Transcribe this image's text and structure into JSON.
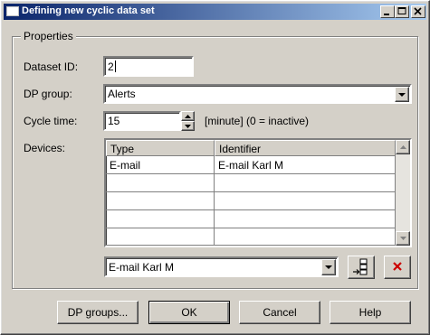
{
  "window": {
    "title": "Defining new cyclic data set"
  },
  "group": {
    "legend": "Properties"
  },
  "dataset": {
    "label": "Dataset ID:",
    "value": "2"
  },
  "dp_group": {
    "label": "DP group:",
    "selected": "Alerts"
  },
  "cycle": {
    "label": "Cycle time:",
    "value": "15",
    "hint": "[minute] (0 = inactive)"
  },
  "devices": {
    "label": "Devices:",
    "columns": [
      "Type",
      "Identifier"
    ],
    "rows": [
      [
        "E-mail",
        "E-mail Karl M"
      ],
      [
        "",
        ""
      ],
      [
        "",
        ""
      ],
      [
        "",
        ""
      ],
      [
        "",
        ""
      ]
    ],
    "selector_value": "E-mail Karl M"
  },
  "buttons": {
    "dp_groups": "DP groups...",
    "ok": "OK",
    "cancel": "Cancel",
    "help": "Help"
  },
  "icons": {
    "add_device": "add-device-icon",
    "delete": "delete-icon"
  },
  "colors": {
    "title_start": "#0a246a",
    "title_end": "#a6caf0",
    "delete": "#cc0000"
  }
}
